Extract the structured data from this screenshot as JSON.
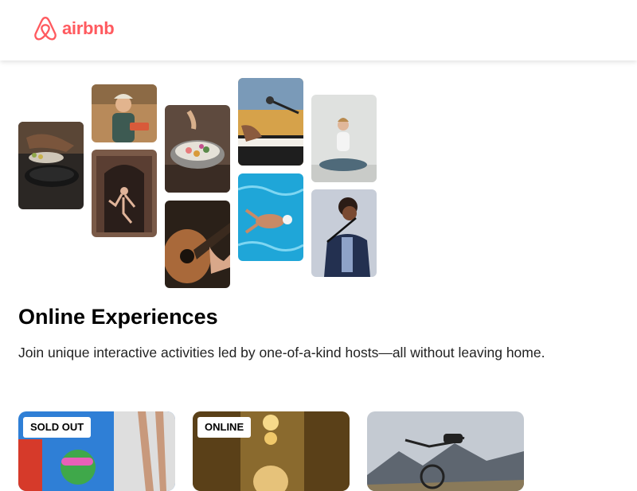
{
  "header": {
    "logo_text": "airbnb",
    "logo_color": "#FF5A5F"
  },
  "hero": {
    "title": "Online Experiences",
    "subtitle": "Join unique interactive activities led by one-of-a-kind hosts—all without leaving home."
  },
  "collage": [
    {
      "subject": "cooking-pan"
    },
    {
      "subject": "woman-serving-food"
    },
    {
      "subject": "dancer-doorway"
    },
    {
      "subject": "plated-dish"
    },
    {
      "subject": "acoustic-guitar"
    },
    {
      "subject": "piano-microphone"
    },
    {
      "subject": "swimmer-pool"
    },
    {
      "subject": "yoga-meditation"
    },
    {
      "subject": "singer-microphone"
    }
  ],
  "cards": [
    {
      "badge": "SOLD OUT",
      "subject": "swimmer-goggles"
    },
    {
      "badge": "ONLINE",
      "subject": "woman-in-lit-hall"
    },
    {
      "badge": "",
      "subject": "bicycle-mountains"
    }
  ],
  "colors": {
    "text_primary": "#222222",
    "heading": "#000000",
    "background": "#FFFFFF"
  }
}
